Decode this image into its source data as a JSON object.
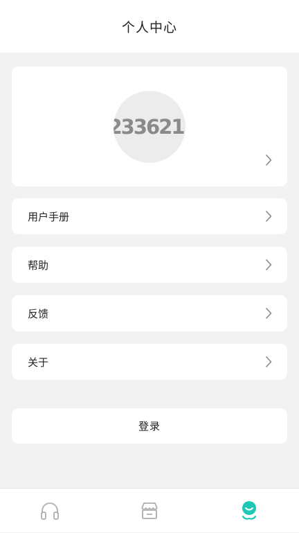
{
  "header": {
    "title": "个人中心"
  },
  "profile": {
    "avatar_text": "233621",
    "avatar_mark": "®"
  },
  "menu": {
    "items": [
      {
        "label": "用户手册"
      },
      {
        "label": "帮助"
      },
      {
        "label": "反馈"
      },
      {
        "label": "关于"
      }
    ]
  },
  "login": {
    "label": "登录"
  },
  "tabbar": {
    "active_index": 2,
    "tabs": [
      {
        "icon": "headphones-icon"
      },
      {
        "icon": "store-icon"
      },
      {
        "icon": "profile-icon"
      }
    ],
    "active_color": "#1ec8b4",
    "inactive_color": "#b5b5b5"
  },
  "colors": {
    "background": "#f2f2f2",
    "card": "#ffffff",
    "text": "#222222",
    "chevron": "#888888"
  }
}
